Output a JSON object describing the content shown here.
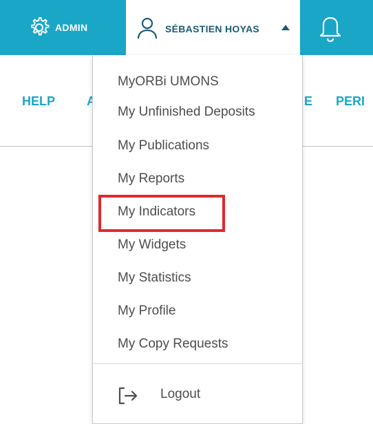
{
  "topbar": {
    "admin_label": "ADMIN",
    "user_name": "SÉBASTIEN HOYAS",
    "icons": [
      "gear-icon",
      "user-icon",
      "caret-up-icon",
      "bell-icon"
    ],
    "colors": {
      "accent": "#1aa6c7",
      "user_text": "#1c5a73"
    }
  },
  "nav": {
    "help": "HELP",
    "partial_a": "A",
    "partial_e": "E",
    "partial_peri": "PERI"
  },
  "dropdown": {
    "items": [
      "MyORBi UMONS",
      "My Unfinished Deposits",
      "My Publications",
      "My Reports",
      "My Indicators",
      "My Widgets",
      "My Statistics",
      "My Profile",
      "My Copy Requests"
    ],
    "highlighted_item": "My Indicators",
    "logout_label": "Logout",
    "logout_icon": "logout-icon",
    "colors": {
      "item_text": "#4d4d4d",
      "highlight": "#e0282e"
    }
  }
}
